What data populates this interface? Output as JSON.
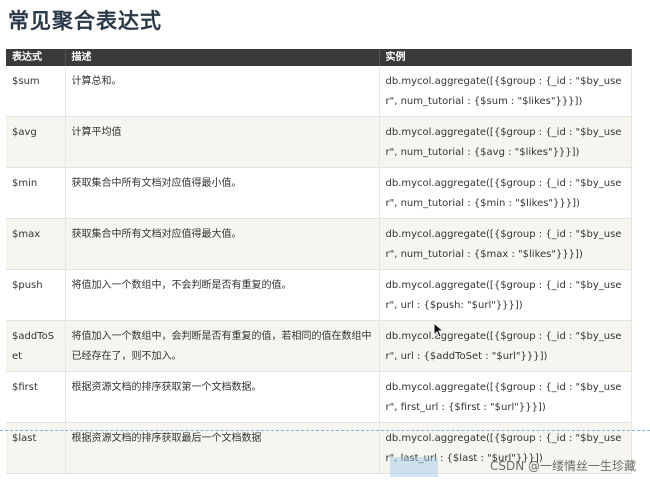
{
  "page": {
    "title": "常见聚合表达式",
    "watermark": "CSDN @一缕情丝一生珍藏"
  },
  "table": {
    "headers": [
      "表达式",
      "描述",
      "实例"
    ],
    "rows": [
      {
        "expr": "$sum",
        "desc": "计算总和。",
        "example": "db.mycol.aggregate([{$group : {_id : \"$by_user\", num_tutorial : {$sum : \"$likes\"}}}])"
      },
      {
        "expr": "$avg",
        "desc": "计算平均值",
        "example": "db.mycol.aggregate([{$group : {_id : \"$by_user\", num_tutorial : {$avg : \"$likes\"}}}])"
      },
      {
        "expr": "$min",
        "desc": "获取集合中所有文档对应值得最小值。",
        "example": "db.mycol.aggregate([{$group : {_id : \"$by_user\", num_tutorial : {$min : \"$likes\"}}}])"
      },
      {
        "expr": "$max",
        "desc": "获取集合中所有文档对应值得最大值。",
        "example": "db.mycol.aggregate([{$group : {_id : \"$by_user\", num_tutorial : {$max : \"$likes\"}}}])"
      },
      {
        "expr": "$push",
        "desc": "将值加入一个数组中，不会判断是否有重复的值。",
        "example": "db.mycol.aggregate([{$group : {_id : \"$by_user\", url : {$push: \"$url\"}}}])"
      },
      {
        "expr": "$addToSet",
        "desc": "将值加入一个数组中，会判断是否有重复的值，若相同的值在数组中已经存在了，则不加入。",
        "example": "db.mycol.aggregate([{$group : {_id : \"$by_user\", url : {$addToSet : \"$url\"}}}])"
      },
      {
        "expr": "$first",
        "desc": "根据资源文档的排序获取第一个文档数据。",
        "example": "db.mycol.aggregate([{$group : {_id : \"$by_user\", first_url : {$first : \"$url\"}}}])"
      },
      {
        "expr": "$last",
        "desc": "根据资源文档的排序获取最后一个文档数据",
        "example": "db.mycol.aggregate([{$group : {_id : \"$by_user\", last_url : {$last : \"$url\"}}}])"
      }
    ]
  },
  "colors": {
    "header_bg": "#3a3a3a",
    "row_alt_bg": "#f6f5ef",
    "title": "#2b3a4a"
  },
  "icons": {
    "cursor": "mouse-pointer-icon"
  }
}
